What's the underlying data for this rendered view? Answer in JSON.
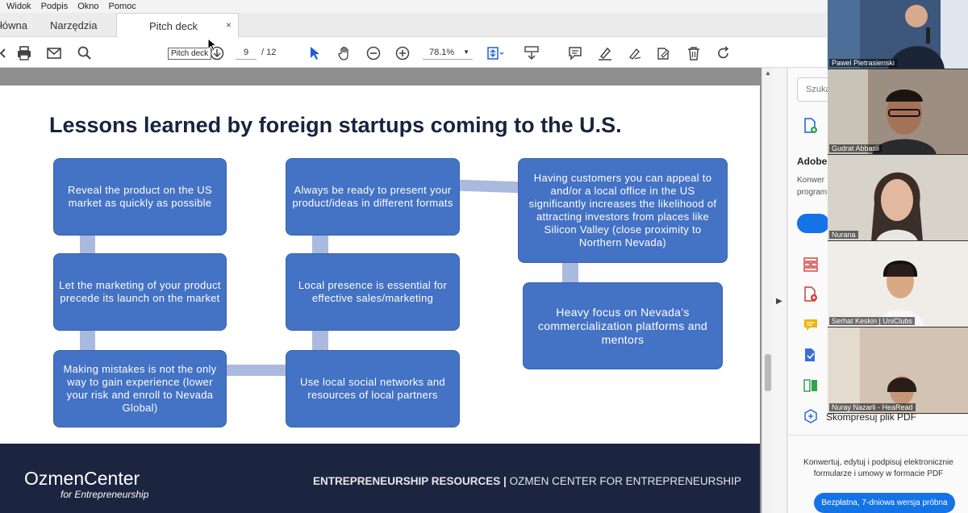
{
  "menu": [
    "Widok",
    "Podpis",
    "Okno",
    "Pomoc"
  ],
  "tabs": {
    "home": "łówna",
    "tools": "Narzędzia",
    "document": "Pitch deck",
    "close": "×"
  },
  "tooltip": "Pitch deck",
  "toolbar": {
    "page_current": "9",
    "page_total": "/ 12",
    "zoom": "78.1%"
  },
  "slide": {
    "title": "Lessons learned by foreign startups coming to the U.S.",
    "boxes": {
      "b1": "Reveal the product on the US market as quickly as possible",
      "b2": "Let the marketing of your product precede its launch on the market",
      "b3": "Making mistakes is not the only way to gain experience (lower your risk and enroll to Nevada Global)",
      "b4": "Always be ready to present your product/ideas in different formats",
      "b5": "Local presence is essential for effective sales/marketing",
      "b6": "Use local social networks and resources of local partners",
      "b7": "Having customers you can appeal to and/or a local office in the US significantly increases the likelihood of attracting investors from places like Silicon Valley (close proximity to Northern Nevada)",
      "b8": "Heavy focus on Nevada’s commercialization platforms and mentors"
    },
    "footer": {
      "brand": "OzmenCenter",
      "brand_sub": "for Entrepreneurship",
      "text_bold": "ENTREPRENEURSHIP RESOURCES |",
      "text_rest": " OZMEN CENTER FOR ENTREPRENEURSHIP"
    }
  },
  "right_panel": {
    "search_placeholder": "Szuka",
    "heading": "Adobe",
    "line1": "Konwer",
    "line2": "program",
    "compress": "Skompresuj plik PDF",
    "promo": "Konwertuj, edytuj i podpisuj elektronicznie formularze i umowy w formacie PDF",
    "trial": "Bezpłatna, 7-dniowa wersja próbna"
  },
  "participants": [
    {
      "name": "Pawel Pietrasienski"
    },
    {
      "name": "Gudrat Abbasli"
    },
    {
      "name": "Nurana"
    },
    {
      "name": "Serhat Keskin | UniClubs"
    },
    {
      "name": "Nuray Nazarli - HeaRead"
    }
  ],
  "colors": {
    "box": "#4472c4",
    "connector": "#aab9de",
    "footer": "#1b2540",
    "title": "#17243f",
    "accent": "#1473e6"
  }
}
